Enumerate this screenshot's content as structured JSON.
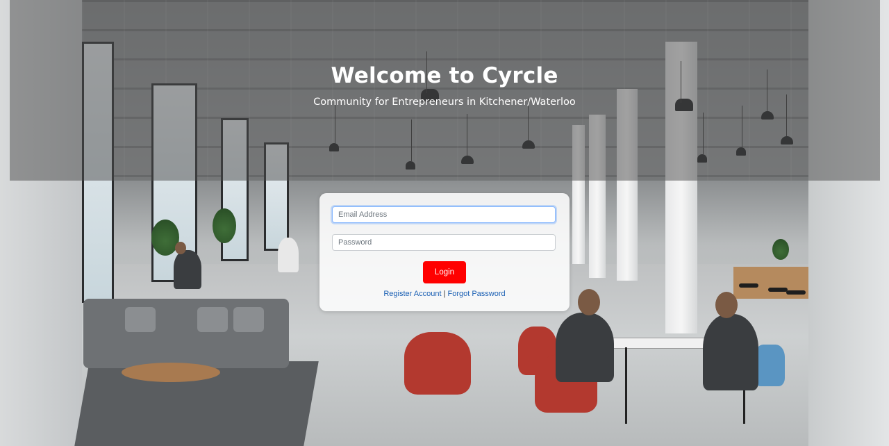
{
  "header": {
    "title": "Welcome to Cyrcle",
    "subtitle": "Community for Entrepreneurs in Kitchener/Waterloo"
  },
  "login_form": {
    "email_placeholder": "Email Address",
    "email_value": "",
    "password_placeholder": "Password",
    "password_value": "",
    "login_label": "Login",
    "register_link": "Register Account",
    "separator": "|",
    "forgot_link": "Forgot Password"
  },
  "colors": {
    "login_button": "#ff0000",
    "link": "#1a5fb4",
    "banner_overlay": "rgba(75,75,75,0.5)"
  }
}
